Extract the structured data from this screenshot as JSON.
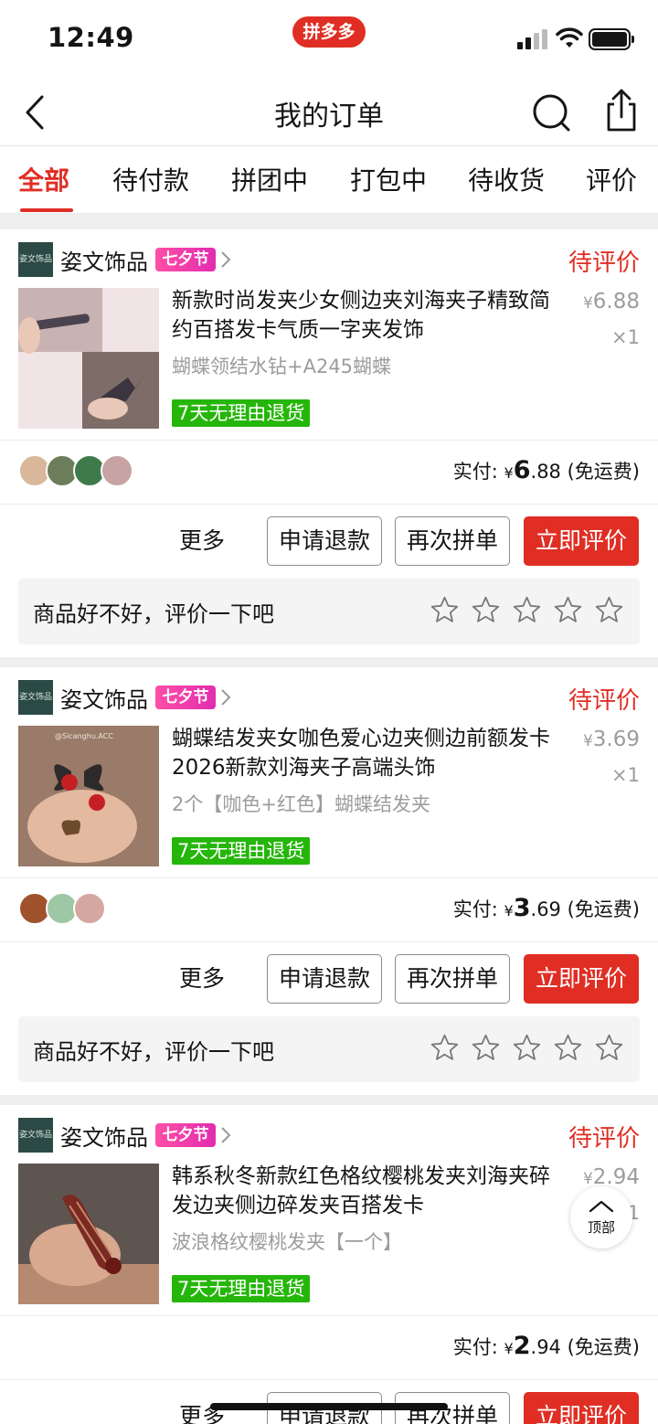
{
  "status_bar": {
    "time": "12:49",
    "app_badge": "拼多多"
  },
  "nav": {
    "title": "我的订单"
  },
  "tabs": [
    "全部",
    "待付款",
    "拼团中",
    "打包中",
    "待收货",
    "评价"
  ],
  "active_tab": "全部",
  "orders": [
    {
      "shop_name": "姿文饰品",
      "shop_logo_text": "姿文饰品",
      "festival_badge": "七夕节",
      "status": "待评价",
      "title": "新款时尚发夹少女侧边夹刘海夹子精致简约百搭发卡气质一字夹发饰",
      "price_symbol": "¥",
      "price": "6.88",
      "qty": "×1",
      "spec": "蝴蝶领结水钻+A245蝴蝶",
      "return_tag": "7天无理由退货",
      "paid_label": "实付:",
      "paid_symbol": "¥",
      "paid_int": "6",
      "paid_dec": ".88",
      "shipping": "(免运费)",
      "more": "更多",
      "btn_refund": "申请退款",
      "btn_again": "再次拼单",
      "btn_review": "立即评价",
      "review_prompt": "商品好不好，评价一下吧"
    },
    {
      "shop_name": "姿文饰品",
      "shop_logo_text": "姿文饰品",
      "festival_badge": "七夕节",
      "status": "待评价",
      "title": "蝴蝶结发夹女咖色爱心边夹侧边前额发卡2026新款刘海夹子高端头饰",
      "price_symbol": "¥",
      "price": "3.69",
      "qty": "×1",
      "spec": "2个【咖色+红色】蝴蝶结发夹",
      "thumb_caption": "@Sicanghu.ACC",
      "return_tag": "7天无理由退货",
      "paid_label": "实付:",
      "paid_symbol": "¥",
      "paid_int": "3",
      "paid_dec": ".69",
      "shipping": "(免运费)",
      "more": "更多",
      "btn_refund": "申请退款",
      "btn_again": "再次拼单",
      "btn_review": "立即评价",
      "review_prompt": "商品好不好，评价一下吧"
    },
    {
      "shop_name": "姿文饰品",
      "shop_logo_text": "姿文饰品",
      "festival_badge": "七夕节",
      "status": "待评价",
      "title": "韩系秋冬新款红色格纹樱桃发夹刘海夹碎发边夹侧边碎发夹百搭发卡",
      "price_symbol": "¥",
      "price": "2.94",
      "qty": "×1",
      "spec": "波浪格纹樱桃发夹【一个】",
      "return_tag": "7天无理由退货",
      "paid_label": "实付:",
      "paid_symbol": "¥",
      "paid_int": "2",
      "paid_dec": ".94",
      "shipping": "(免运费)",
      "more": "更多",
      "btn_refund": "申请退款",
      "btn_again": "再次拼单",
      "btn_review": "立即评价"
    }
  ],
  "back_to_top": "顶部",
  "colors": {
    "accent": "#e02e24",
    "return_tag": "#25b60a",
    "festival": "#ff4fa6"
  }
}
